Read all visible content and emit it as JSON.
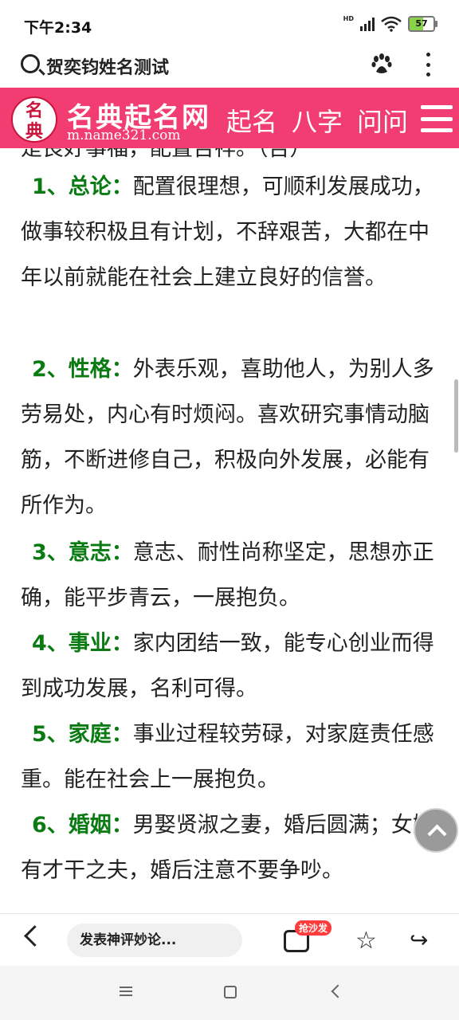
{
  "status_bar": {
    "time": "下午2:34",
    "network": "HD",
    "battery": "57"
  },
  "search_bar": {
    "title": "贺奕钧姓名测试"
  },
  "site_header": {
    "seal_chars": [
      "名",
      "典"
    ],
    "logo_title": "名典起名网",
    "logo_url": "m.name321.com",
    "nav": [
      "起名",
      "八字",
      "问问"
    ]
  },
  "article": {
    "partial_top": "是良好事福，配置吉祥。（吉）",
    "sections": [
      {
        "num": "1、总论：",
        "text": "配置很理想，可顺利发展成功，做事较积极且有计划，不辞艰苦，大都在中年以前就能在社会上建立良好的信誉。"
      },
      {
        "num": "2、性格：",
        "text": "外表乐观，喜助他人，为别人多劳易处，内心有时烦闷。喜欢研究事情动脑筋，不断进修自己，积极向外发展，必能有所作为。"
      },
      {
        "num": "3、意志：",
        "text": "意志、耐性尚称坚定，思想亦正确，能平步青云，一展抱负。"
      },
      {
        "num": "4、事业：",
        "text": "家内团结一致，能专心创业而得到成功发展，名利可得。"
      },
      {
        "num": "5、家庭：",
        "text": "事业过程较劳碌，对家庭责任感重。能在社会上一展抱负。"
      },
      {
        "num": "6、婚姻：",
        "text": "男娶贤淑之妻，婚后圆满；女嫁有才干之夫，婚后注意不要争吵。"
      }
    ]
  },
  "toolbar": {
    "comment_placeholder": "发表神评妙论...",
    "badge": "抢沙发"
  },
  "icons": {
    "star": "☆",
    "share": "↪"
  }
}
